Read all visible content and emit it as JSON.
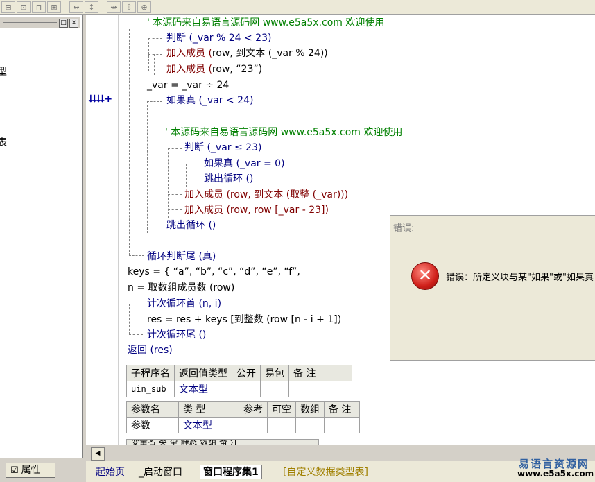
{
  "toolbar": {
    "icons": [
      "align-left-icon",
      "align-center-icon",
      "align-top-icon",
      "align-middle-icon",
      "same-width-icon",
      "same-height-icon",
      "horizontal-space-icon",
      "vertical-space-icon",
      "center-icon"
    ]
  },
  "left_panel": {
    "glyph1": "型",
    "glyph2": "表",
    "min_label": "□",
    "close_label": "×",
    "property_button": "属性"
  },
  "code": {
    "lines": [
      {
        "id": "l1",
        "text": "' 本源码来自易语言源码网 www.e5a5x.com  欢迎使用"
      },
      {
        "id": "l2",
        "text": "判断 (_var % 24 < 23)"
      },
      {
        "id": "l3a",
        "text": "加入成员 ("
      },
      {
        "id": "l3b",
        "text": "row, 到文本 (_var % 24))"
      },
      {
        "id": "l4a",
        "text": "加入成员 ("
      },
      {
        "id": "l4b",
        "text": "row, “23”)"
      },
      {
        "id": "l5",
        "text": "_var = _var ÷ 24"
      },
      {
        "id": "l6",
        "text": "如果真 (_var < 24)"
      },
      {
        "id": "l7",
        "text": "' 本源码来自易语言源码网 www.e5a5x.com  欢迎使用"
      },
      {
        "id": "l8",
        "text": "判断 (_var ≤ 23)"
      },
      {
        "id": "l9",
        "text": "如果真 (_var = 0)"
      },
      {
        "id": "l10",
        "text": "跳出循环 ()"
      },
      {
        "id": "l11",
        "text": "加入成员 (row, 到文本 (取整 (_var)))"
      },
      {
        "id": "l12",
        "text": "加入成员 (row, row [_var - 23])"
      },
      {
        "id": "l13",
        "text": "跳出循环 ()"
      },
      {
        "id": "l14",
        "text": "循环判断尾 (真)"
      },
      {
        "id": "l15",
        "text": "keys = { “a”, “b”, “c”, “d”, “e”, “f”,"
      },
      {
        "id": "l16",
        "text": "n = 取数组成员数 (row)"
      },
      {
        "id": "l17",
        "text": "计次循环首 (n, i)"
      },
      {
        "id": "l18",
        "text": "res = res + keys [到整数 (row [n - i + 1])"
      },
      {
        "id": "l19",
        "text": "计次循环尾 ()"
      },
      {
        "id": "l20",
        "text": "返回 (res)"
      }
    ],
    "gutter_marker": "⮇⮇+"
  },
  "sub_table": {
    "headers": [
      "子程序名",
      "返回值类型",
      "公开",
      "易包",
      "备 注"
    ],
    "row": [
      "uin_sub",
      "文本型",
      "",
      "",
      ""
    ]
  },
  "param_table": {
    "headers": [
      "参数名",
      "类 型",
      "参考",
      "可空",
      "数组",
      "备 注"
    ],
    "row": [
      "参数",
      "文本型",
      "",
      "",
      "",
      ""
    ]
  },
  "partial_table_row": "变量名   类 型   静态   数组   备 注",
  "tabs": [
    "起始页",
    "_启动窗口",
    "窗口程序集1",
    "[自定义数据类型表]"
  ],
  "dialog": {
    "title": "错误:",
    "message": "错误：所定义块与某\"如果\"或\"如果真"
  },
  "watermark": {
    "line1": "易语言资源网",
    "line2": "www.e5a5x.com"
  }
}
